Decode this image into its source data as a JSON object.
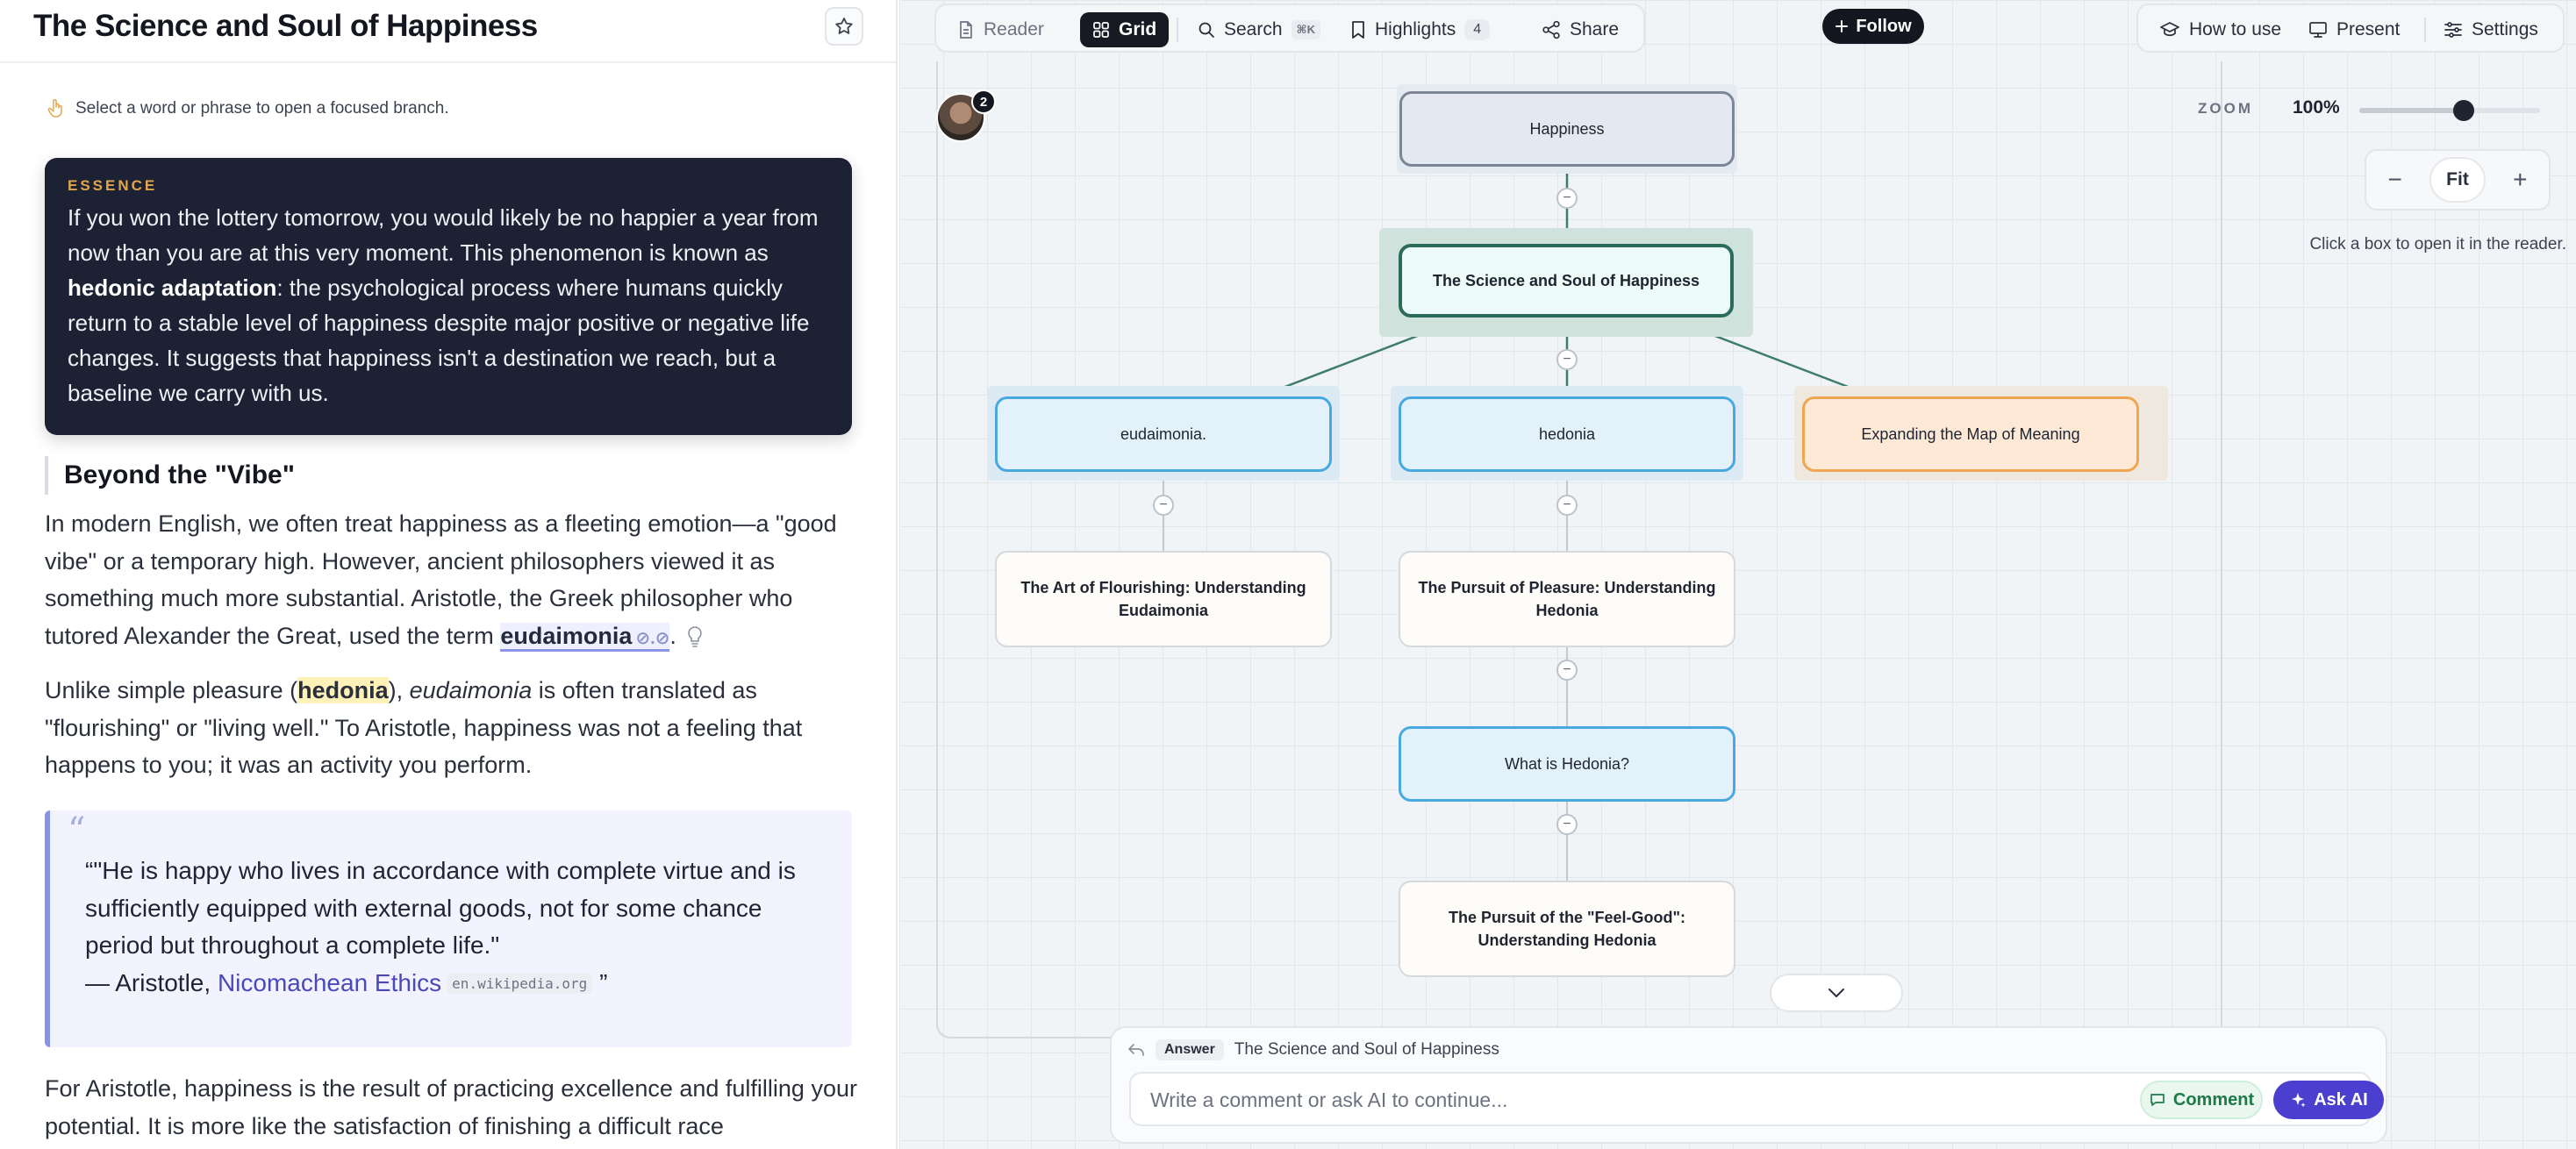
{
  "reader": {
    "title": "The Science and Soul of Happiness",
    "hint": "Select a word or phrase to open a focused branch.",
    "essence": {
      "label": "ESSENCE",
      "text_before": "If you won the lottery tomorrow, you would likely be no happier a year from now than you are at this very moment. This phenomenon is known as ",
      "bold": "hedonic adaptation",
      "text_after": ": the psychological process where humans quickly return to a stable level of happiness despite major positive or negative life changes. It suggests that happiness isn't a destination we reach, but a baseline we carry with us."
    },
    "section_heading": "Beyond the \"Vibe\"",
    "para1": {
      "text": "In modern English, we often treat happiness as a fleeting emotion—a \"good vibe\" or a temporary high. However, ancient philosophers viewed it as something much more substantial. Aristotle, the Greek philosopher who tutored Alexander the Great, used the term ",
      "term": "eudaimonia",
      "term_suffix": "."
    },
    "para2": {
      "pre": "Unlike simple pleasure (",
      "highlight": "hedonia",
      "mid": "), ",
      "italic": "eudaimonia",
      "post": " is often translated as \"flourishing\" or \"living well.\" To Aristotle, happiness was not a feeling that happens to you; it was an activity you perform."
    },
    "quote": {
      "mark": "“",
      "text": "“\"He is happy who lives in accordance with complete virtue and is sufficiently equipped with external goods, not for some chance period but throughout a complete life.\"",
      "attr_prefix": "— Aristotle, ",
      "link": "Nicomachean Ethics",
      "source": "en.wikipedia.org",
      "close": "”"
    },
    "para3": "For Aristotle, happiness is the result of practicing excellence and fulfilling your potential. It is more like the satisfaction of finishing a difficult race"
  },
  "toolbar": {
    "reader": "Reader",
    "grid": "Grid",
    "search": "Search",
    "search_kbd": "⌘K",
    "highlights": "Highlights",
    "highlights_count": "4",
    "share": "Share",
    "follow": "Follow",
    "how_to_use": "How to use",
    "present": "Present",
    "settings": "Settings"
  },
  "zoom": {
    "label": "ZOOM",
    "value": "100%",
    "level": 0.58,
    "minus": "−",
    "fit": "Fit",
    "plus": "+"
  },
  "canvas_hint": "Click a box to open it in the reader.",
  "avatar_badge": "2",
  "nodes": {
    "root": "Happiness",
    "current": "The Science and Soul of Happiness",
    "eudaimonia": "eudaimonia.",
    "hedonia": "hedonia",
    "map": "Expanding the Map of Meaning",
    "art": "The Art of Flourishing: Understanding Eudaimonia",
    "pursuit": "The Pursuit of Pleasure: Understanding Hedonia",
    "what": "What is Hedonia?",
    "feelgood": "The Pursuit of the \"Feel-Good\": Understanding Hedonia"
  },
  "composer": {
    "answer": "Answer",
    "target": "The Science and Soul of Happiness",
    "placeholder": "Write a comment or ask AI to continue...",
    "comment": "Comment",
    "ask_ai": "Ask AI"
  },
  "colors": {
    "accent": "#4b3fd0",
    "current_border": "#2a6b5b",
    "blue_border": "#4aa8e0",
    "orange_border": "#f0a552",
    "essence_bg": "#1c2233"
  }
}
